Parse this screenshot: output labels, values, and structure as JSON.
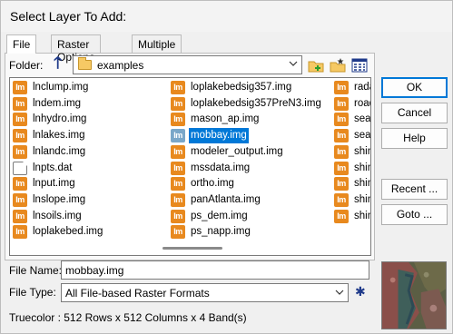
{
  "window": {
    "title": "Select Layer To Add:"
  },
  "tabs": [
    "File",
    "Raster Options",
    "Multiple"
  ],
  "folder": {
    "label": "Folder:",
    "value": "examples"
  },
  "files": [
    {
      "name": "lnclump.img",
      "type": "img"
    },
    {
      "name": "lndem.img",
      "type": "img"
    },
    {
      "name": "lnhydro.img",
      "type": "img"
    },
    {
      "name": "lnlakes.img",
      "type": "img"
    },
    {
      "name": "lnlandc.img",
      "type": "img"
    },
    {
      "name": "lnpts.dat",
      "type": "dat"
    },
    {
      "name": "lnput.img",
      "type": "img"
    },
    {
      "name": "lnslope.img",
      "type": "img"
    },
    {
      "name": "lnsoils.img",
      "type": "img"
    },
    {
      "name": "loplakebed.img",
      "type": "img"
    },
    {
      "name": "loplakebedsig357.img",
      "type": "img"
    },
    {
      "name": "loplakebedsig357PreN3.img",
      "type": "img"
    },
    {
      "name": "mason_ap.img",
      "type": "img"
    },
    {
      "name": "mobbay.img",
      "type": "img",
      "selected": true
    },
    {
      "name": "modeler_output.img",
      "type": "img"
    },
    {
      "name": "mssdata.img",
      "type": "img"
    },
    {
      "name": "ortho.img",
      "type": "img"
    },
    {
      "name": "panAtlanta.img",
      "type": "img"
    },
    {
      "name": "ps_dem.img",
      "type": "img"
    },
    {
      "name": "ps_napp.img",
      "type": "img"
    },
    {
      "name": "radar",
      "type": "img"
    },
    {
      "name": "road",
      "type": "img"
    },
    {
      "name": "seatt",
      "type": "img"
    },
    {
      "name": "seatt",
      "type": "img"
    },
    {
      "name": "shine",
      "type": "img"
    },
    {
      "name": "shine",
      "type": "img"
    },
    {
      "name": "shine",
      "type": "img"
    },
    {
      "name": "shine",
      "type": "img"
    },
    {
      "name": "shine",
      "type": "img"
    }
  ],
  "buttons": {
    "ok": "OK",
    "cancel": "Cancel",
    "help": "Help",
    "recent": "Recent ...",
    "goto": "Goto ..."
  },
  "filename": {
    "label": "File Name:",
    "value": "mobbay.img"
  },
  "filetype": {
    "label": "File Type:",
    "value": "All File-based Raster Formats"
  },
  "status": "Truecolor : 512 Rows x 512 Columns x 4 Band(s)",
  "icons": {
    "up": "up-arrow-icon",
    "new_folder": "new-folder-icon",
    "favorite": "favorite-folder-icon",
    "view": "list-view-icon",
    "file": "erdas-img-file-icon"
  },
  "colors": {
    "accent": "#0078d7",
    "file_icon": "#e8891e"
  }
}
